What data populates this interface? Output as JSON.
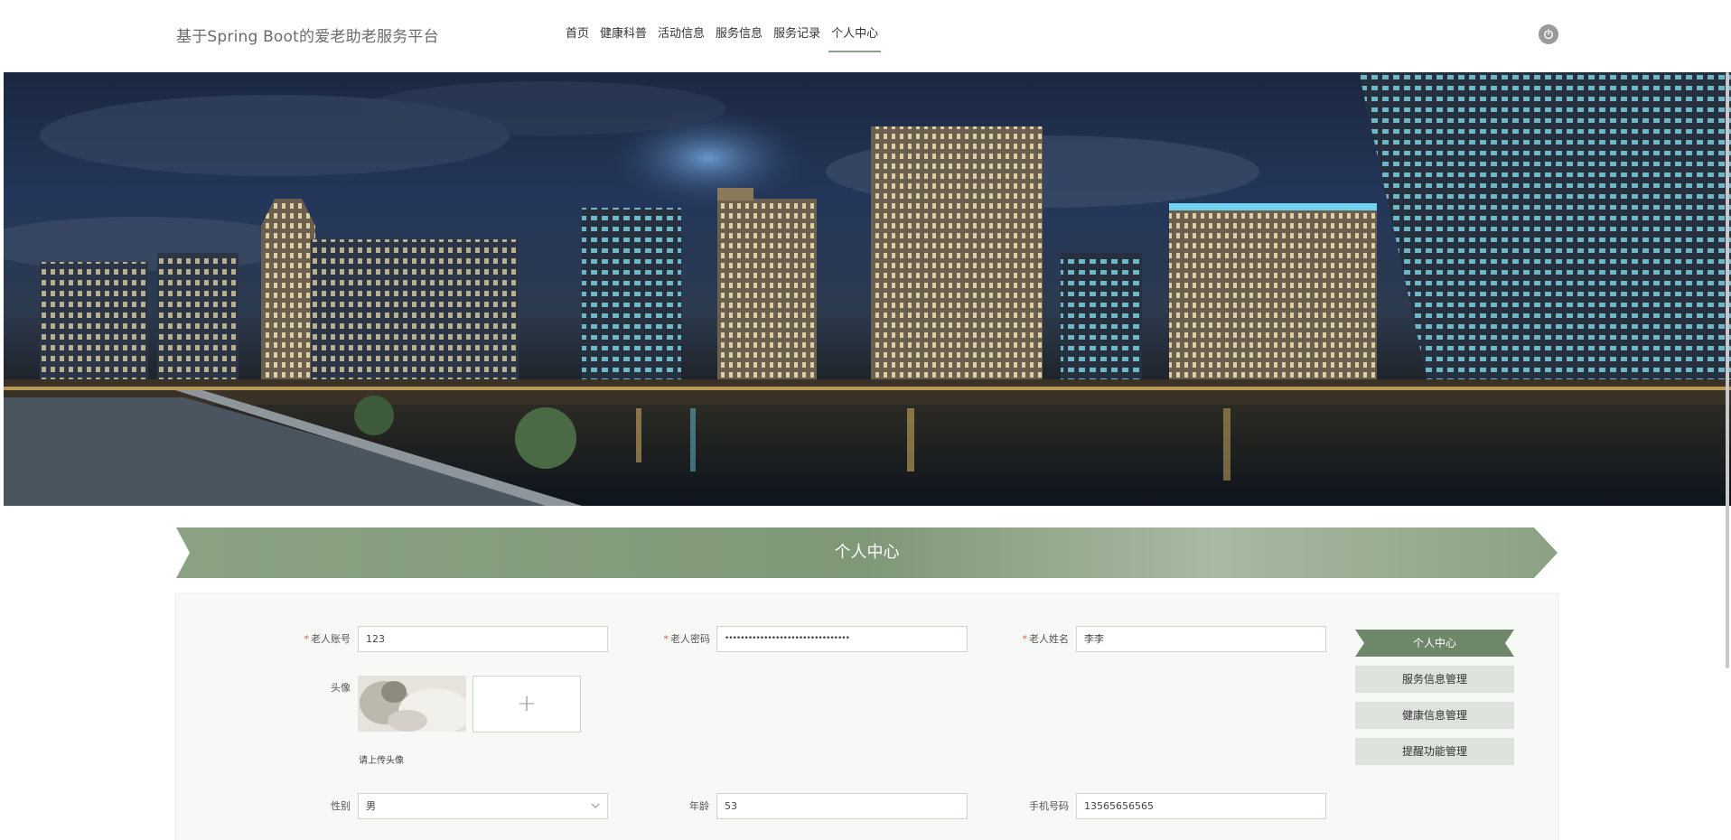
{
  "header": {
    "brand": "基于Spring Boot的爱老助老服务平台",
    "nav": [
      "首页",
      "健康科普",
      "活动信息",
      "服务信息",
      "服务记录",
      "个人中心"
    ],
    "active_nav": "个人中心",
    "logout_icon": "power-icon"
  },
  "section": {
    "title": "个人中心"
  },
  "form": {
    "account_label": "老人账号",
    "account_value": "123",
    "password_label": "老人密码",
    "password_value": "••••••••••••••••••••••••••••••••",
    "name_label": "老人姓名",
    "name_value": "李李",
    "avatar_label": "头像",
    "avatar_hint": "请上传头像",
    "upload_icon": "+",
    "gender_label": "性别",
    "gender_value": "男",
    "age_label": "年龄",
    "age_value": "53",
    "phone_label": "手机号码",
    "phone_value": "13565656565"
  },
  "side_menu": {
    "items": [
      "个人中心",
      "服务信息管理",
      "健康信息管理",
      "提醒功能管理"
    ],
    "active": "个人中心"
  },
  "colors": {
    "accent": "#8aa283",
    "accent_dark": "#6d8768",
    "side_item_bg": "#dde2dc"
  }
}
